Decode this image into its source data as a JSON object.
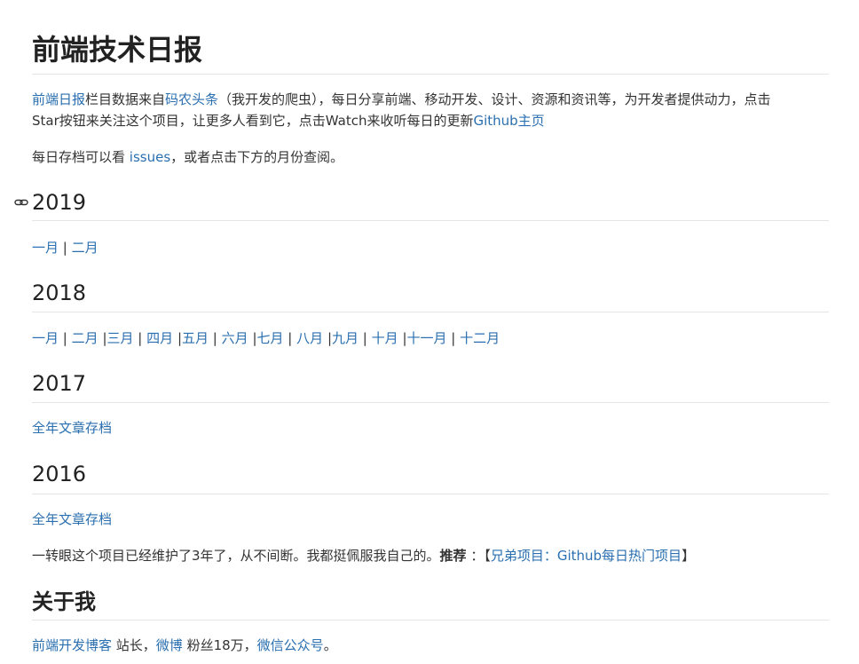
{
  "title": "前端技术日报",
  "intro": {
    "link1": "前端日报",
    "t1": "栏目数据来自",
    "link2": "码农头条",
    "t2": "（我开发的爬虫），每日分享前端、移动开发、设计、资源和资讯等，为开发者提供动力，点击",
    "t3": "Star按钮来关注这个项目，让更多人看到它，点击Watch来收听每日的更新",
    "link3": "Github主页"
  },
  "archive": {
    "t1": "每日存档可以看 ",
    "issues": "issues",
    "t2": "，或者点击下方的月份查阅。"
  },
  "sections": {
    "y2019": {
      "year": "2019",
      "months": [
        "一月",
        "二月"
      ]
    },
    "y2018": {
      "year": "2018",
      "months": [
        "一月",
        "二月",
        "三月",
        "四月",
        "五月",
        "六月",
        "七月",
        "八月",
        "九月",
        "十月",
        "十一月",
        "十二月"
      ]
    },
    "y2017": {
      "year": "2017",
      "link": "全年文章存档"
    },
    "y2016": {
      "year": "2016",
      "link": "全年文章存档"
    }
  },
  "sep": "|",
  "closing": {
    "t1": "一转眼这个项目已经维护了3年了，从不间断。我都挺佩服我自己的。",
    "bold": "推荐",
    "t2": " ：【",
    "link": "兄弟项目：Github每日热门项目",
    "t3": "】"
  },
  "about": {
    "heading": "关于我",
    "link1": "前端开发博客",
    "t1": " 站长，",
    "link2": "微博",
    "t2": " 粉丝18万，",
    "link3": "微信公众号",
    "t3": "。"
  }
}
